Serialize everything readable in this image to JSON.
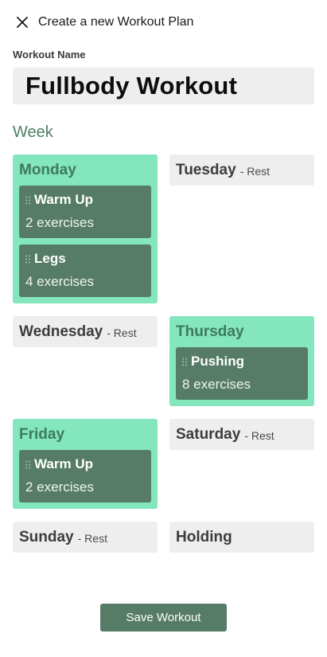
{
  "header": {
    "title": "Create a new Workout Plan",
    "close_icon": "close-icon"
  },
  "workout_name": {
    "label": "Workout Name",
    "value": "Fullbody Workout"
  },
  "week_label": "Week",
  "days": {
    "monday": {
      "name": "Monday",
      "blocks": [
        {
          "name": "Warm Up",
          "count": "2 exercises"
        },
        {
          "name": "Legs",
          "count": "4 exercises"
        }
      ]
    },
    "tuesday": {
      "name": "Tuesday",
      "rest": "- Rest"
    },
    "wednesday": {
      "name": "Wednesday",
      "rest": "- Rest"
    },
    "thursday": {
      "name": "Thursday",
      "blocks": [
        {
          "name": "Pushing",
          "count": "8 exercises"
        }
      ]
    },
    "friday": {
      "name": "Friday",
      "blocks": [
        {
          "name": "Warm Up",
          "count": "2 exercises"
        }
      ]
    },
    "saturday": {
      "name": "Saturday",
      "rest": "- Rest"
    },
    "sunday": {
      "name": "Sunday",
      "rest": "- Rest"
    },
    "holding": {
      "name": "Holding"
    }
  },
  "save_button": "Save Workout",
  "colors": {
    "accent": "#567c67",
    "active_day": "#83e6bc",
    "rest_day": "#eeeeee",
    "week_label": "#4f7f67"
  }
}
